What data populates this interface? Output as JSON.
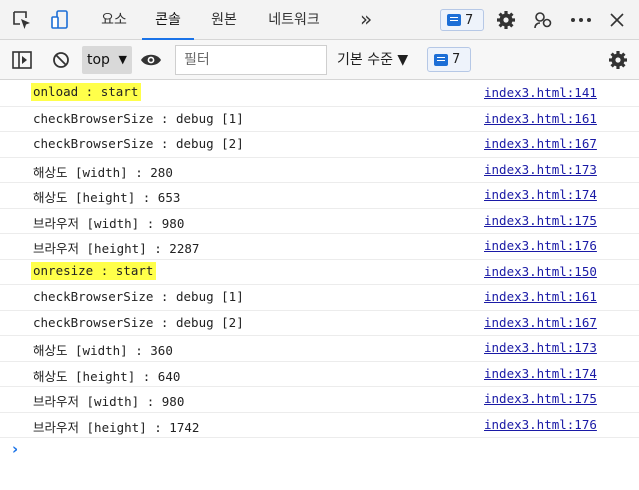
{
  "tabs": [
    {
      "label": "요소",
      "active": false
    },
    {
      "label": "콘솔",
      "active": true
    },
    {
      "label": "원본",
      "active": false
    },
    {
      "label": "네트워크",
      "active": false
    }
  ],
  "more_tabs_label": "»",
  "top_badge_count": "7",
  "toolbar": {
    "context_value": "top",
    "filter_placeholder": "필터",
    "levels_label": "기본 수준 ▼",
    "issues_count": "7"
  },
  "console_rows": [
    {
      "message": "onload : start",
      "source": "index3.html:141",
      "highlight": true
    },
    {
      "message": "checkBrowserSize : debug [1]",
      "source": "index3.html:161"
    },
    {
      "message": "checkBrowserSize : debug [2]",
      "source": "index3.html:167"
    },
    {
      "message": "해상도 [width] : 280",
      "source": "index3.html:173"
    },
    {
      "message": "해상도 [height] : 653",
      "source": "index3.html:174"
    },
    {
      "message": "브라우저 [width] : 980",
      "source": "index3.html:175"
    },
    {
      "message": "브라우저 [height] : 2287",
      "source": "index3.html:176"
    },
    {
      "message": "onresize : start",
      "source": "index3.html:150",
      "highlight": true
    },
    {
      "message": "checkBrowserSize : debug [1]",
      "source": "index3.html:161"
    },
    {
      "message": "checkBrowserSize : debug [2]",
      "source": "index3.html:167"
    },
    {
      "message": "해상도 [width] : 360",
      "source": "index3.html:173"
    },
    {
      "message": "해상도 [height] : 640",
      "source": "index3.html:174"
    },
    {
      "message": "브라우저 [width] : 980",
      "source": "index3.html:175"
    },
    {
      "message": "브라우저 [height] : 1742",
      "source": "index3.html:176"
    }
  ],
  "prompt_symbol": "›",
  "colors": {
    "highlight": "#ffff4a",
    "link": "#1a1aa6",
    "accent": "#1a73e8"
  },
  "icons": [
    "inspect-icon",
    "device-emulation-icon",
    "settings-gear-icon",
    "connection-icon",
    "more-dots-icon",
    "close-icon",
    "sidebar-toggle-icon",
    "clear-console-icon",
    "live-expression-eye-icon",
    "console-settings-gear-icon"
  ]
}
